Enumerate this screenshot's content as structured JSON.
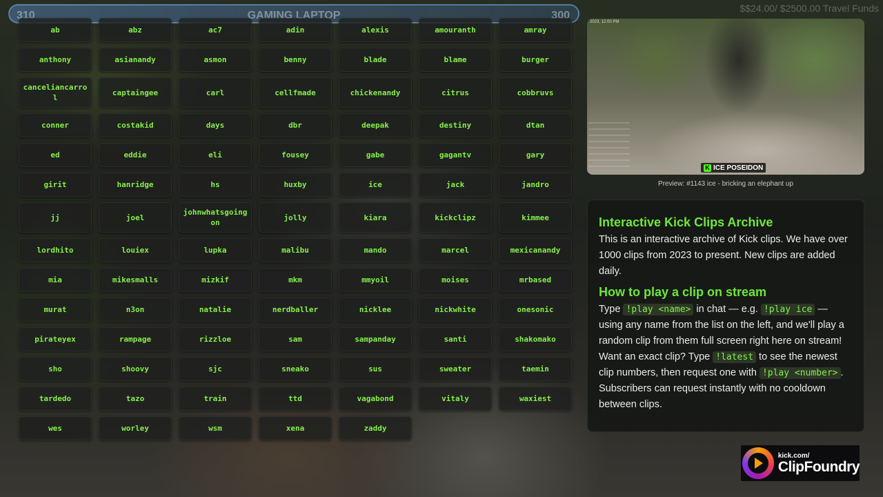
{
  "goal": {
    "left_value": "310",
    "title": "GAMING LAPTOP",
    "right_value": "300",
    "top_right_text": "$$24.00/ $2500.00 Travel Funds"
  },
  "names": [
    "ab",
    "abz",
    "ac7",
    "adin",
    "alexis",
    "amouranth",
    "amray",
    "anthony",
    "asianandy",
    "asmon",
    "benny",
    "blade",
    "blame",
    "burger",
    "canceliancarrol",
    "captaingee",
    "carl",
    "cellfmade",
    "chickenandy",
    "citrus",
    "cobbruvs",
    "conner",
    "costakid",
    "days",
    "dbr",
    "deepak",
    "destiny",
    "dtan",
    "ed",
    "eddie",
    "eli",
    "fousey",
    "gabe",
    "gagantv",
    "gary",
    "girit",
    "hanridge",
    "hs",
    "huxby",
    "ice",
    "jack",
    "jandro",
    "jj",
    "joel",
    "johnwhatsgoingon",
    "jolly",
    "kiara",
    "kickclipz",
    "kimmee",
    "lordhito",
    "louiex",
    "lupka",
    "malibu",
    "mando",
    "marcel",
    "mexicanandy",
    "mia",
    "mikesmalls",
    "mizkif",
    "mkm",
    "mmyoil",
    "moises",
    "mrbased",
    "murat",
    "n3on",
    "natalie",
    "nerdballer",
    "nicklee",
    "nickwhite",
    "onesonic",
    "pirateyex",
    "rampage",
    "rizzloe",
    "sam",
    "sampanday",
    "santi",
    "shakomako",
    "sho",
    "shoovy",
    "sjc",
    "sneako",
    "sus",
    "sweater",
    "taemin",
    "tardedo",
    "tazo",
    "train",
    "ttd",
    "vagabond",
    "vitaly",
    "waxiest",
    "wes",
    "worley",
    "wsm",
    "xena",
    "zaddy"
  ],
  "preview": {
    "timestamp": "2023, 12:00 PM",
    "streamer_tag": "ICE POSEIDON",
    "caption": "Preview: #1143 ice - bricking an elephant up"
  },
  "info": {
    "heading1": "Interactive Kick Clips Archive",
    "intro": "This is an interactive archive of Kick clips. We have over 1000 clips from 2023 to present. New clips are added daily.",
    "heading2": "How to play a clip on stream",
    "p_type": "Type ",
    "cmd_play_name": "!play <name>",
    "p_in_chat": " in chat — e.g. ",
    "cmd_play_ice": "!play ice",
    "p_rest1": " — using any name from the list on the left, and we'll play a random clip from them full screen right here on stream! Want an exact clip? Type ",
    "cmd_latest": "!latest",
    "p_rest2": " to see the newest clip numbers, then request one with ",
    "cmd_play_number": "!play <number>",
    "p_rest3": ". Subscribers can request instantly with no cooldown between clips."
  },
  "brand": {
    "small": "kick.com/",
    "big": "ClipFoundry"
  }
}
